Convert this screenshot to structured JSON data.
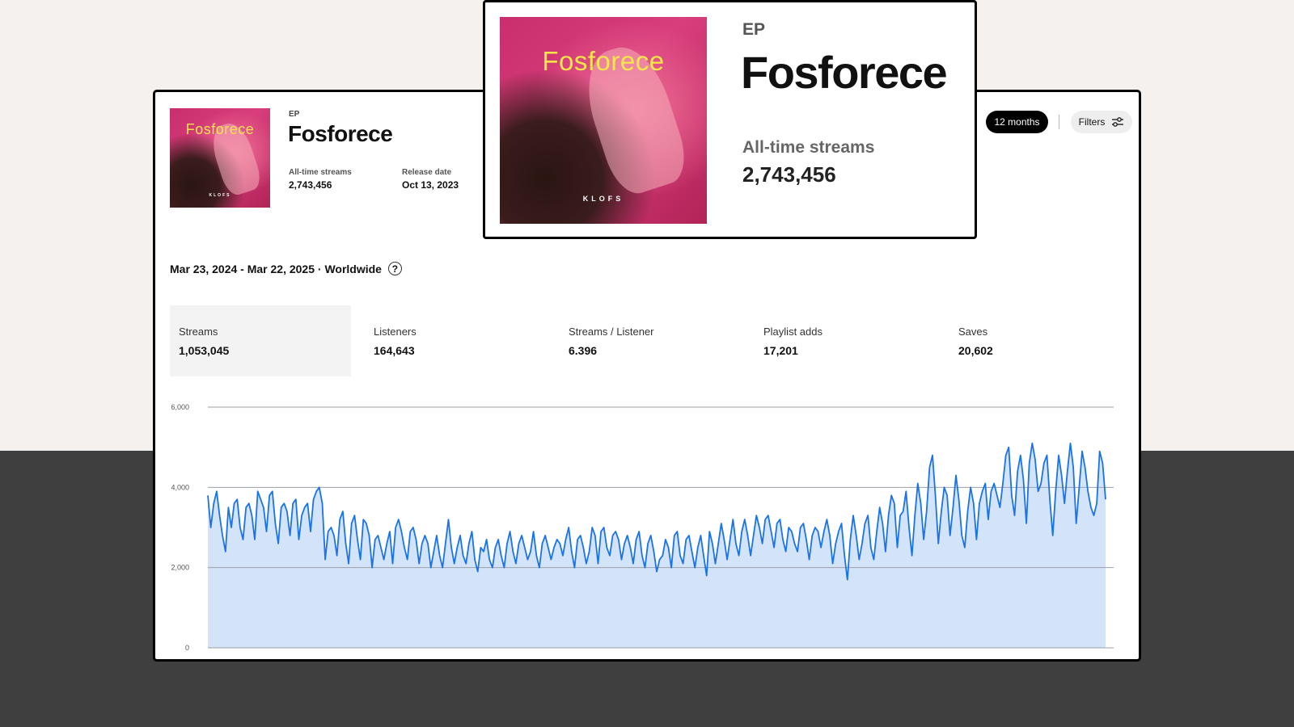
{
  "album": {
    "type": "EP",
    "title": "Fosforece",
    "artist": "KLOFS",
    "all_time_streams_label": "All-time streams",
    "all_time_streams": "2,743,456",
    "release_date_label": "Release date",
    "release_date": "Oct 13, 2023"
  },
  "controls": {
    "period": "12 months",
    "filters": "Filters"
  },
  "range": {
    "text": "Mar 23, 2024 - Mar 22, 2025 · Worldwide",
    "help": "?"
  },
  "metrics": [
    {
      "label": "Streams",
      "value": "1,053,045",
      "active": true
    },
    {
      "label": "Listeners",
      "value": "164,643",
      "active": false
    },
    {
      "label": "Streams / Listener",
      "value": "6.396",
      "active": false
    },
    {
      "label": "Playlist adds",
      "value": "17,201",
      "active": false
    },
    {
      "label": "Saves",
      "value": "20,602",
      "active": false
    }
  ],
  "colors": {
    "line": "#1a73e8",
    "fill": "#d3e3f8",
    "grid": "#9aa0a6",
    "active_button": "#000000"
  },
  "icons": {
    "filters": "sliders-icon",
    "help": "question-circle-icon"
  },
  "chart_data": {
    "type": "area",
    "title": "",
    "xlabel": "",
    "ylabel": "",
    "ylim": [
      0,
      6000
    ],
    "yticks": [
      0,
      2000,
      4000,
      6000
    ],
    "ytick_labels": [
      "0",
      "2,000",
      "4,000",
      "6,000"
    ],
    "grid": true,
    "series": [
      {
        "values": [
          3800,
          3000,
          3600,
          3900,
          3300,
          2800,
          2400,
          3500,
          3000,
          3600,
          3700,
          3000,
          2700,
          3500,
          3600,
          3300,
          2700,
          3900,
          3700,
          3500,
          2900,
          3800,
          3900,
          3100,
          2600,
          3500,
          3600,
          3400,
          2800,
          3600,
          3700,
          2700,
          3300,
          3500,
          3600,
          2900,
          3700,
          3900,
          4000,
          3600,
          2200,
          2900,
          3000,
          2800,
          2300,
          3200,
          3400,
          2600,
          2100,
          3100,
          3300,
          2700,
          2200,
          3200,
          3100,
          2800,
          2000,
          2700,
          2800,
          2500,
          2200,
          2600,
          2900,
          2100,
          3000,
          3200,
          2900,
          2500,
          2200,
          2900,
          3000,
          2700,
          2100,
          2600,
          2800,
          2600,
          2000,
          2400,
          2800,
          2300,
          2000,
          2600,
          3200,
          2500,
          2100,
          2500,
          2800,
          2300,
          2100,
          2600,
          2900,
          2200,
          1900,
          2500,
          2400,
          2700,
          2200,
          2000,
          2500,
          2700,
          2300,
          2000,
          2600,
          2900,
          2400,
          2100,
          2600,
          2800,
          2500,
          2200,
          2400,
          2900,
          2300,
          2000,
          2600,
          2800,
          2500,
          2200,
          2500,
          2700,
          2600,
          2300,
          2700,
          3000,
          2400,
          2000,
          2700,
          2800,
          2500,
          2100,
          2400,
          3000,
          2800,
          2100,
          2900,
          3000,
          2500,
          2300,
          2800,
          2900,
          2700,
          2200,
          2600,
          2800,
          2500,
          2100,
          2700,
          2900,
          2300,
          2000,
          2600,
          2800,
          2400,
          1900,
          2200,
          2300,
          2700,
          2500,
          2000,
          2800,
          2900,
          2300,
          2100,
          2700,
          2800,
          2400,
          2000,
          2500,
          2800,
          2300,
          1800,
          2900,
          2600,
          2100,
          2600,
          3100,
          2700,
          2200,
          2700,
          3200,
          2600,
          2300,
          2900,
          3200,
          2800,
          2300,
          2800,
          3300,
          3000,
          2600,
          3200,
          3300,
          2900,
          2500,
          3100,
          3200,
          2700,
          2400,
          3000,
          2900,
          2600,
          2400,
          3000,
          3100,
          2700,
          2200,
          2800,
          3000,
          2900,
          2500,
          2900,
          3200,
          2800,
          2100,
          2600,
          2900,
          3100,
          2300,
          1700,
          2700,
          3300,
          2800,
          2200,
          2600,
          3100,
          3300,
          2500,
          2200,
          2900,
          3500,
          3100,
          2400,
          3300,
          3800,
          3600,
          2500,
          3300,
          3400,
          3900,
          3000,
          2300,
          3300,
          4100,
          3600,
          2700,
          3400,
          4500,
          4800,
          3800,
          2600,
          3400,
          4000,
          3800,
          2800,
          3500,
          4300,
          3700,
          2800,
          2500,
          3400,
          4000,
          3600,
          2700,
          3600,
          3900,
          4100,
          3200,
          3900,
          4100,
          3800,
          3500,
          4100,
          4800,
          5000,
          3800,
          3300,
          4400,
          4800,
          4200,
          3100,
          4600,
          5100,
          4700,
          3900,
          4100,
          4600,
          4800,
          3700,
          2800,
          3900,
          4800,
          4300,
          3600,
          4400,
          5100,
          4500,
          3100,
          4000,
          4900,
          4500,
          3900,
          3500,
          3300,
          3600,
          4900,
          4600,
          3700
        ]
      }
    ]
  }
}
